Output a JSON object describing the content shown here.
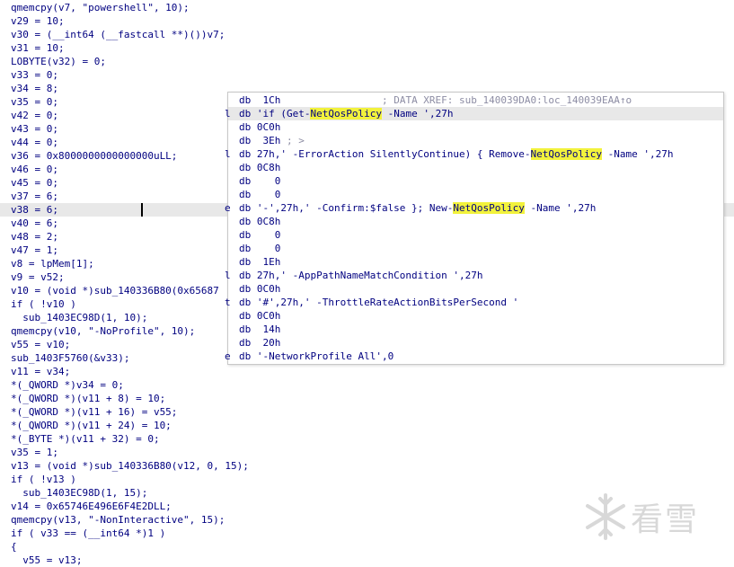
{
  "code_lines": [
    "qmemcpy(v7, \"powershell\", 10);",
    "v29 = 10;",
    "v30 = (__int64 (__fastcall **)())v7;",
    "v31 = 10;",
    "LOBYTE(v32) = 0;",
    "v33 = 0;",
    "v34 = 8;",
    "v35 = 0;",
    "v42 = 0;",
    "v43 = 0;",
    "v44 = 0;",
    "v36 = 0x8000000000000000uLL;",
    "v46 = 0;",
    "v45 = 0;",
    "v37 = 6;",
    "v38 = 6;",
    "v40 = 6;",
    "v48 = 2;",
    "v47 = 1;",
    "v8 = lpMem[1];",
    "v9 = v52;",
    "v10 = (void *)sub_140336B80(0x65687",
    "if ( !v10 )",
    "  sub_1403EC98D(1, 10);",
    "qmemcpy(v10, \"-NoProfile\", 10);",
    "v55 = v10;",
    "sub_1403F5760(&v33);",
    "v11 = v34;",
    "*(_QWORD *)v34 = 0;",
    "*(_QWORD *)(v11 + 8) = 10;",
    "*(_QWORD *)(v11 + 16) = v55;",
    "*(_QWORD *)(v11 + 24) = 10;",
    "*(_BYTE *)(v11 + 32) = 0;",
    "v35 = 1;",
    "v13 = (void *)sub_140336B80(v12, 0, 15);",
    "if ( !v13 )",
    "  sub_1403EC98D(1, 15);",
    "v14 = 0x65746E496E6F4E2DLL;",
    "qmemcpy(v13, \"-NonInteractive\", 15);",
    "if ( v33 == (__int64 *)1 )",
    "{",
    "  v55 = v13;"
  ],
  "popup": {
    "lines": [
      {
        "prefix": "",
        "a": "db  1Ch                 ",
        "b": "; DATA XREF: sub_140039DA0:loc_140039EAA↑o",
        "c": ""
      },
      {
        "prefix": "l",
        "a": "db 'if (Get-",
        "b": "NetQosPolicy",
        "c": " -Name ',27h"
      },
      {
        "prefix": "",
        "a": "db 0C0h",
        "b": "",
        "c": ""
      },
      {
        "prefix": "",
        "a": "db  3Eh ",
        "b": "; >",
        "c": ""
      },
      {
        "prefix": "l",
        "a": "db 27h,' -ErrorAction SilentlyContinue) { Remove-",
        "b": "NetQosPolicy",
        "c": " -Name ',27h"
      },
      {
        "prefix": "",
        "a": "db 0C8h",
        "b": "",
        "c": ""
      },
      {
        "prefix": "",
        "a": "db    0",
        "b": "",
        "c": ""
      },
      {
        "prefix": "",
        "a": "db    0",
        "b": "",
        "c": ""
      },
      {
        "prefix": "e",
        "a": "db '-',27h,' -Confirm:$false }; New-",
        "b": "NetQosPolicy",
        "c": " -Name ',27h"
      },
      {
        "prefix": "",
        "a": "db 0C8h",
        "b": "",
        "c": ""
      },
      {
        "prefix": "",
        "a": "db    0",
        "b": "",
        "c": ""
      },
      {
        "prefix": "",
        "a": "db    0",
        "b": "",
        "c": ""
      },
      {
        "prefix": "",
        "a": "db  1Eh",
        "b": "",
        "c": ""
      },
      {
        "prefix": "l",
        "a": "db 27h,' -AppPathNameMatchCondition ',27h",
        "b": "",
        "c": ""
      },
      {
        "prefix": "",
        "a": "db 0C0h",
        "b": "",
        "c": ""
      },
      {
        "prefix": "t",
        "a": "db '#',27h,' -ThrottleRateActionBitsPerSecond '",
        "b": "",
        "c": ""
      },
      {
        "prefix": "",
        "a": "db 0C0h",
        "b": "",
        "c": ""
      },
      {
        "prefix": "",
        "a": "db  14h",
        "b": "",
        "c": ""
      },
      {
        "prefix": "",
        "a": "db  20h",
        "b": "",
        "c": ""
      },
      {
        "prefix": "e",
        "a": "db '-NetworkProfile All',0",
        "b": "",
        "c": ""
      }
    ],
    "selected_index": 1
  },
  "highlighted_code_line": 15,
  "watermark": {
    "text": "看雪",
    "icon": "snowflake-icon"
  },
  "colors": {
    "code_text": "#000080",
    "highlight_yellow": "#f2f23c",
    "comment_gray": "#8d8da4",
    "selected_line_bg": "#e8e8e8"
  }
}
